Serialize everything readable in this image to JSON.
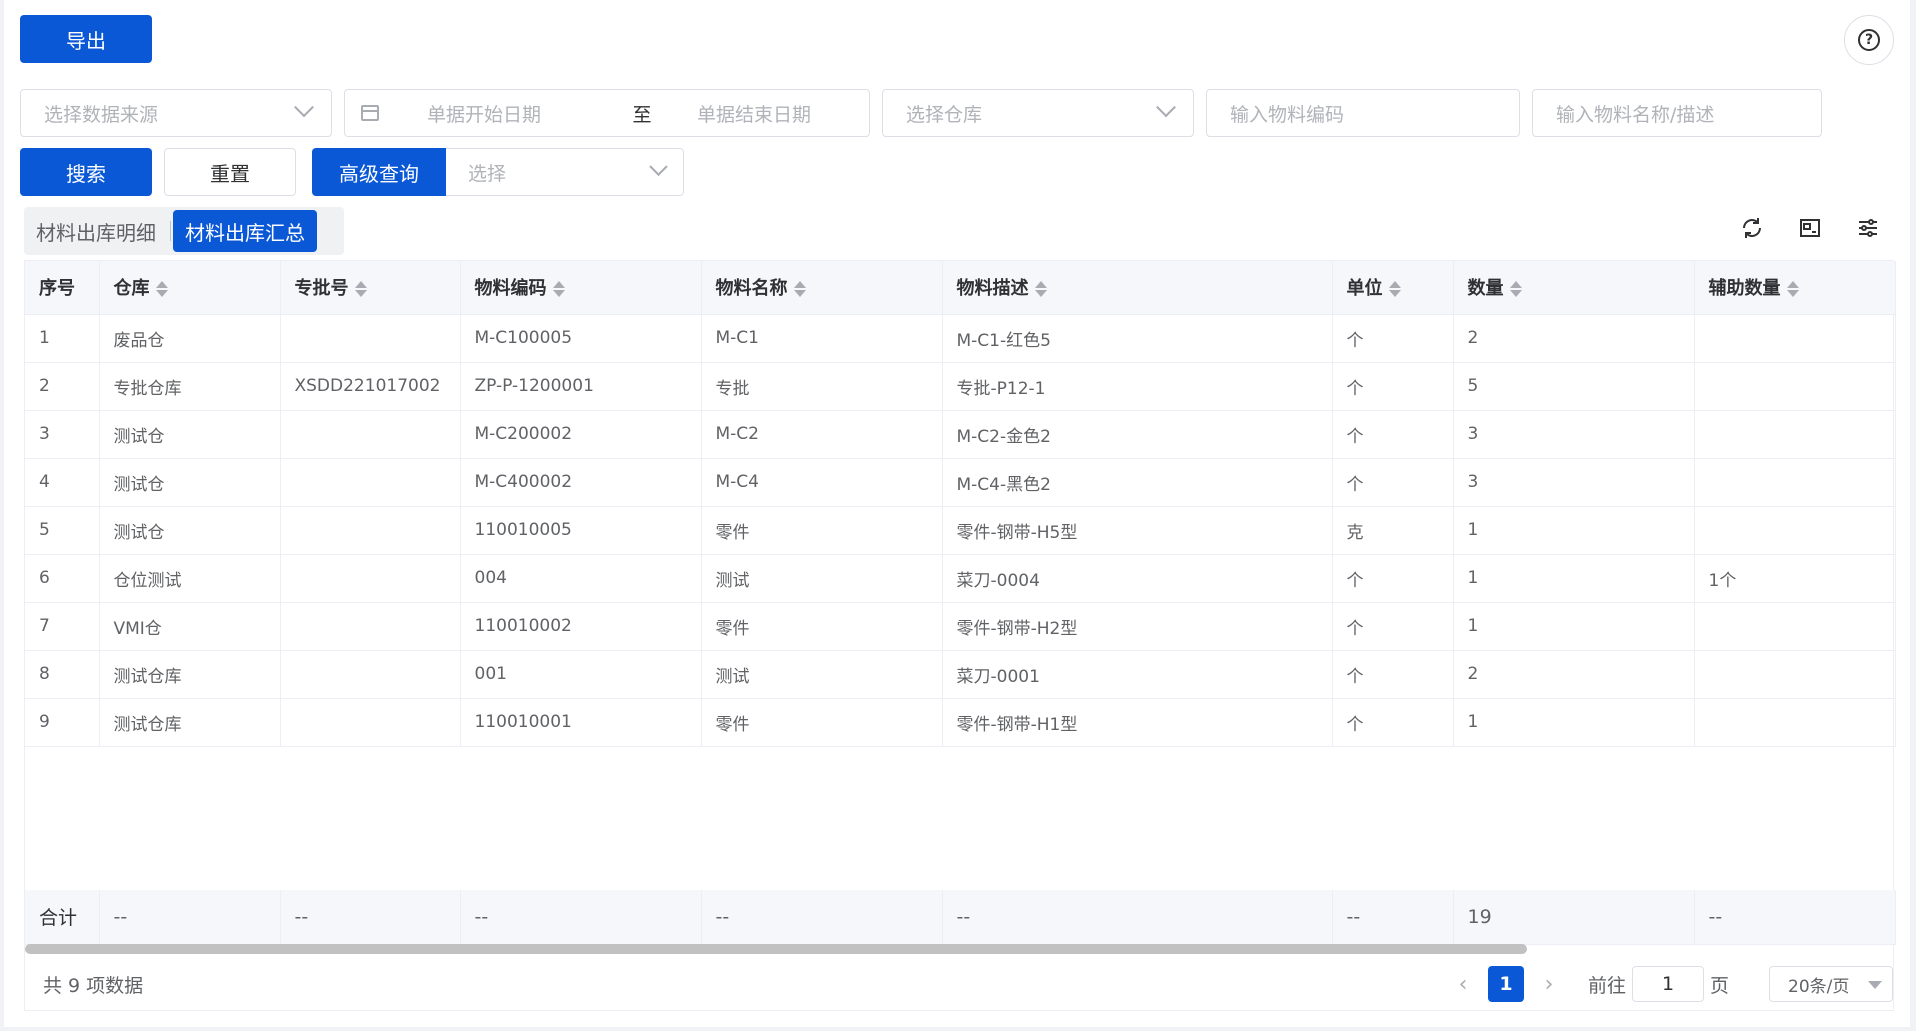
{
  "toolbar": {
    "export_label": "导出"
  },
  "help": {
    "glyph": "?"
  },
  "filters": {
    "source_placeholder": "选择数据来源",
    "date_start_placeholder": "单据开始日期",
    "date_separator": "至",
    "date_end_placeholder": "单据结束日期",
    "warehouse_placeholder": "选择仓库",
    "material_code_placeholder": "输入物料编码",
    "material_name_placeholder": "输入物料名称/描述"
  },
  "actions": {
    "search_label": "搜索",
    "reset_label": "重置",
    "advanced_label": "高级查询",
    "advanced_select_placeholder": "选择"
  },
  "tabs": [
    {
      "label": "材料出库明细",
      "active": false
    },
    {
      "label": "材料出库汇总",
      "active": true
    }
  ],
  "table": {
    "columns": [
      "序号",
      "仓库",
      "专批号",
      "物料编码",
      "物料名称",
      "物料描述",
      "单位",
      "数量",
      "辅助数量"
    ],
    "rows": [
      [
        "1",
        "废品仓",
        "",
        "M-C100005",
        "M-C1",
        "M-C1-红色5",
        "个",
        "2",
        ""
      ],
      [
        "2",
        "专批仓库",
        "XSDD221017002",
        "ZP-P-1200001",
        "专批",
        "专批-P12-1",
        "个",
        "5",
        ""
      ],
      [
        "3",
        "测试仓",
        "",
        "M-C200002",
        "M-C2",
        "M-C2-金色2",
        "个",
        "3",
        ""
      ],
      [
        "4",
        "测试仓",
        "",
        "M-C400002",
        "M-C4",
        "M-C4-黑色2",
        "个",
        "3",
        ""
      ],
      [
        "5",
        "测试仓",
        "",
        "110010005",
        "零件",
        "零件-钢带-H5型",
        "克",
        "1",
        ""
      ],
      [
        "6",
        "仓位测试",
        "",
        "004",
        "测试",
        "菜刀-0004",
        "个",
        "1",
        "1个"
      ],
      [
        "7",
        "VMI仓",
        "",
        "110010002",
        "零件",
        "零件-钢带-H2型",
        "个",
        "1",
        ""
      ],
      [
        "8",
        "测试仓库",
        "",
        "001",
        "测试",
        "菜刀-0001",
        "个",
        "2",
        ""
      ],
      [
        "9",
        "测试仓库",
        "",
        "110010001",
        "零件",
        "零件-钢带-H1型",
        "个",
        "1",
        ""
      ]
    ],
    "summary": [
      "合计",
      "--",
      "--",
      "--",
      "--",
      "--",
      "--",
      "19",
      "--"
    ]
  },
  "footer": {
    "total_text": "共 9 项数据",
    "current_page": "1",
    "goto_label": "前往",
    "goto_value": "1",
    "page_suffix": "页",
    "page_size": "20条/页"
  },
  "colors": {
    "primary": "#0a58d6"
  }
}
